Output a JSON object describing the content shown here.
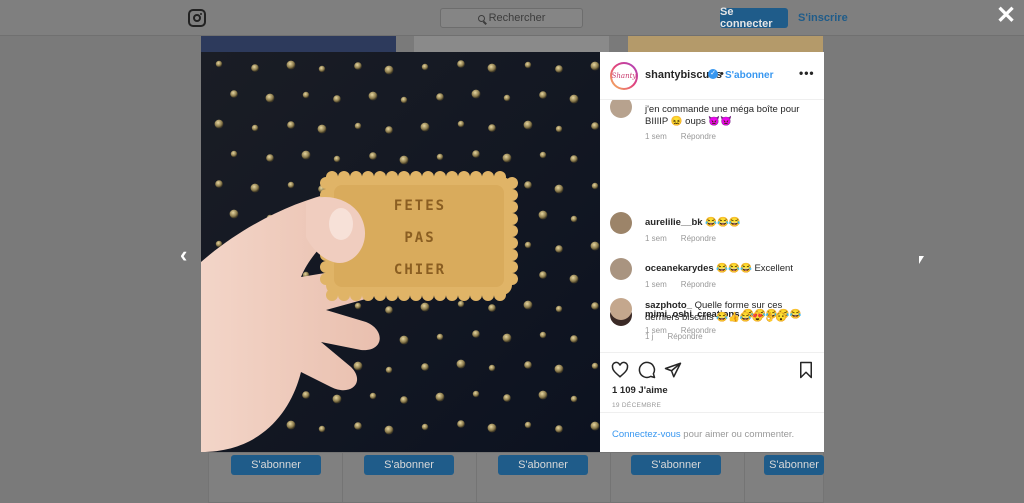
{
  "header": {
    "search_placeholder": "Rechercher",
    "login_label": "Se connecter",
    "signup_label": "S'inscrire",
    "close_label": "✕"
  },
  "background": {
    "follow_buttons": [
      "S'abonner",
      "S'abonner",
      "S'abonner",
      "S'abonner",
      "S'abonner"
    ]
  },
  "post": {
    "username": "shantybiscuits",
    "avatar_text": "Shanty",
    "follow_label": "S'abonner",
    "more_label": "•••",
    "biscuit_text": [
      "FETES",
      "PAS",
      "CHIER"
    ],
    "comments": [
      {
        "text": "j'en commande une méga boîte pour BIIIIP 😖 oups 👿👿",
        "time": "1 sem",
        "reply": "Répondre"
      },
      {
        "user": "aurelilie__bk",
        "text": "😂😂😂",
        "time": "1 sem",
        "reply": "Répondre"
      },
      {
        "user": "oceanekarydes",
        "text": "😂😂😂 Excellent",
        "time": "1 sem",
        "reply": "Répondre"
      },
      {
        "user": "mimi_oshi_creations",
        "text": "😂😂😂😂😂",
        "time": "1 sem",
        "reply": "Répondre"
      },
      {
        "user": "sazphoto_",
        "text": "Quelle forme sur ces derniers biscuits 😂👍😂😍👌😯",
        "time": "1 j",
        "reply": "Répondre"
      }
    ],
    "likes": "1 109 J'aime",
    "date": "19 DÉCEMBRE",
    "login_prompt_link": "Connectez-vous",
    "login_prompt_rest": " pour aimer ou commenter."
  },
  "nav": {
    "prev_label": "‹"
  },
  "colors": {
    "accent": "#3897f0",
    "dimmed_button": "#1f5c8a",
    "photo_bg": "#0e1420"
  },
  "icons": [
    "instagram-logo-icon",
    "search-icon",
    "close-icon",
    "chevron-left-icon",
    "verified-icon",
    "more-icon",
    "heart-icon",
    "comment-icon",
    "share-icon",
    "bookmark-icon",
    "cursor-icon"
  ]
}
